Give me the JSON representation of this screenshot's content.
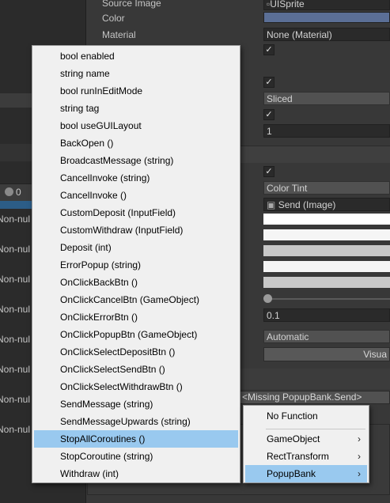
{
  "inspector": {
    "source_image_label": "Source Image",
    "source_image_value": "UISprite",
    "color_label": "Color",
    "material_label": "Material",
    "material_value": "None (Material)",
    "image_type_value": "Sliced",
    "pixels_per_unit_value": "1",
    "transition_value": "Color Tint",
    "target_graphic_value": "Send (Image)",
    "color_multiplier_value": "0.1",
    "navigation_value": "Automatic",
    "visualize_label": "Visua",
    "missing_method_value": "<Missing PopupBank.Send>",
    "checkmark": "✓"
  },
  "console": {
    "count": "0",
    "row_label": "Non-nul"
  },
  "menu": {
    "items": [
      "bool enabled",
      "string name",
      "bool runInEditMode",
      "string tag",
      "bool useGUILayout",
      "BackOpen ()",
      "BroadcastMessage (string)",
      "CancelInvoke (string)",
      "CancelInvoke ()",
      "CustomDeposit (InputField)",
      "CustomWithdraw (InputField)",
      "Deposit (int)",
      "ErrorPopup (string)",
      "OnClickBackBtn ()",
      "OnClickCancelBtn (GameObject)",
      "OnClickErrorBtn ()",
      "OnClickPopupBtn (GameObject)",
      "OnClickSelectDepositBtn ()",
      "OnClickSelectSendBtn ()",
      "OnClickSelectWithdrawBtn ()",
      "SendMessage (string)",
      "SendMessageUpwards (string)",
      "StopAllCoroutines ()",
      "StopCoroutine (string)",
      "Withdraw (int)"
    ],
    "selected_index": 22
  },
  "submenu": {
    "no_function": "No Function",
    "items": [
      "GameObject",
      "RectTransform",
      "PopupBank"
    ],
    "arrow": "›"
  },
  "colors": {
    "menu_highlight": "#99c9ef",
    "editor_dark": "#383838",
    "selection_blue": "#2c5d87",
    "color_field_blue": "#5b6f96"
  }
}
